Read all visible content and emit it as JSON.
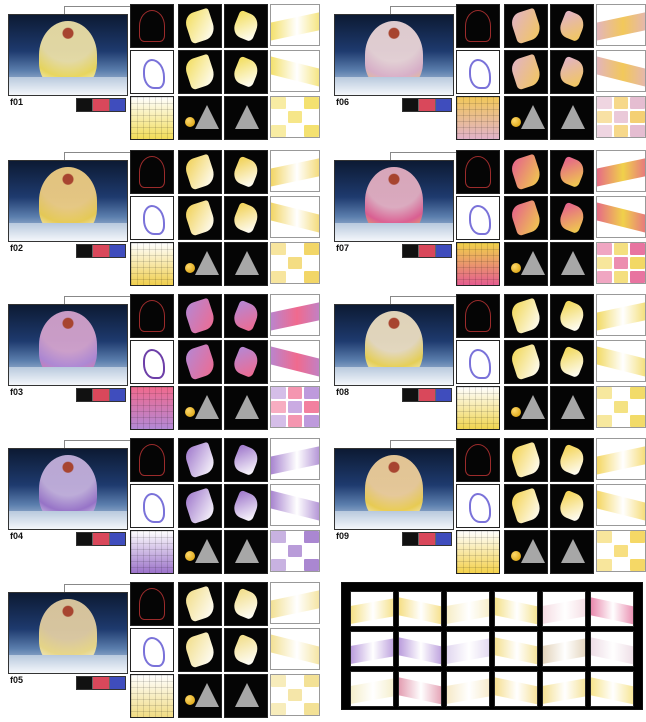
{
  "panels": [
    {
      "label": "f01",
      "accent": "#f2dc57",
      "dancer": "#f1e4a8",
      "secondary": "#ffffff",
      "legend": [
        "#111111",
        "#d9485b",
        "#3f4dbd"
      ]
    },
    {
      "label": "f02",
      "accent": "#f0cf4e",
      "dancer": "#f4d184",
      "secondary": "#ffffff",
      "legend": [
        "#111111",
        "#d9485b",
        "#3f4dbd"
      ]
    },
    {
      "label": "f03",
      "accent": "#b388d6",
      "dancer": "#d8a5cf",
      "secondary": "#f06a8e",
      "legend": [
        "#111111",
        "#d9485b",
        "#3f4dbd"
      ]
    },
    {
      "label": "f04",
      "accent": "#9b72c9",
      "dancer": "#c8b3df",
      "secondary": "#ffffff",
      "legend": [
        "#111111",
        "#d9485b",
        "#3f4dbd"
      ]
    },
    {
      "label": "f05",
      "accent": "#f1dc84",
      "dancer": "#e6d0a3",
      "secondary": "#ffffff",
      "legend": [
        "#111111",
        "#d9485b",
        "#3f4dbd"
      ]
    },
    {
      "label": "f06",
      "accent": "#e1b2c9",
      "dancer": "#f0d9da",
      "secondary": "#f2c85a",
      "legend": [
        "#111111",
        "#d9485b",
        "#3f4dbd"
      ]
    },
    {
      "label": "f07",
      "accent": "#e45c8f",
      "dancer": "#e9b2c4",
      "secondary": "#f0d14a",
      "legend": [
        "#111111",
        "#d9485b",
        "#3f4dbd"
      ]
    },
    {
      "label": "f08",
      "accent": "#f0d54f",
      "dancer": "#f1e2c3",
      "secondary": "#ffffff",
      "legend": [
        "#111111",
        "#d9485b",
        "#3f4dbd"
      ]
    },
    {
      "label": "f09",
      "accent": "#f3d14b",
      "dancer": "#f4d29b",
      "secondary": "#ffffff",
      "legend": [
        "#111111",
        "#d9485b",
        "#3f4dbd"
      ]
    }
  ],
  "mosaic": {
    "tile_colors": [
      "#f1d55a",
      "#f2d35a",
      "#f4e7b3",
      "#f0d65f",
      "#f1d0d9",
      "#e05e8f",
      "#a27ad0",
      "#a27ad0",
      "#d7c9ea",
      "#f0d56a",
      "#d8c3a2",
      "#e7d0dc",
      "#f1e8b8",
      "#d97b96",
      "#f3e2b5",
      "#f2d36a",
      "#f0d66c",
      "#f3da63"
    ]
  }
}
